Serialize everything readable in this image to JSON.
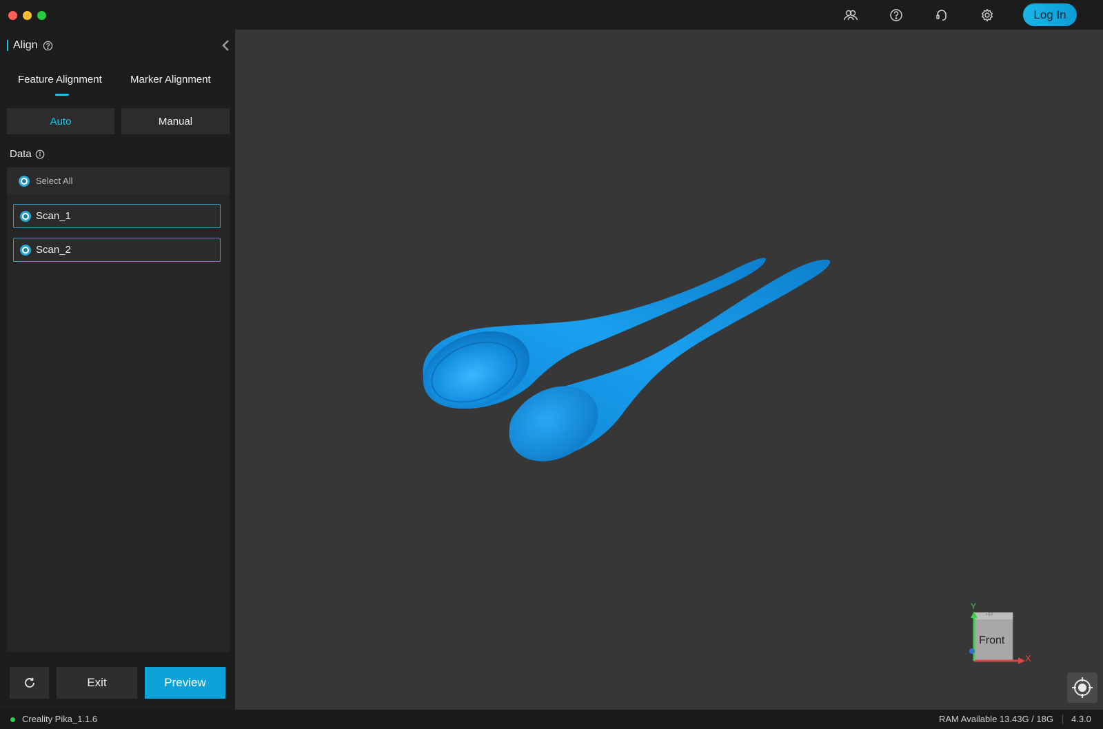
{
  "window": {
    "colors": {
      "accent": "#18c5e8",
      "primary_button": "#0ea2d9",
      "model": "#0f8fd6"
    }
  },
  "topbar": {
    "icons": [
      "community-icon",
      "help-icon",
      "support-icon",
      "settings-icon"
    ],
    "login_label": "Log In"
  },
  "sidebar": {
    "title": "Align",
    "tabs": [
      {
        "label": "Feature Alignment",
        "active": true
      },
      {
        "label": "Marker Alignment",
        "active": false
      }
    ],
    "modes": [
      {
        "label": "Auto",
        "active": true
      },
      {
        "label": "Manual",
        "active": false
      }
    ],
    "data_label": "Data",
    "select_all_label": "Select All",
    "scans": [
      {
        "label": "Scan_1",
        "selected": true
      },
      {
        "label": "Scan_2",
        "selected": true
      }
    ],
    "buttons": {
      "exit": "Exit",
      "preview": "Preview"
    }
  },
  "viewport": {
    "nav_cube": {
      "face_front": "Front",
      "face_top": "Top",
      "axis_x": "X",
      "axis_y": "Y"
    }
  },
  "statusbar": {
    "app_name": "Creality Pika_1.1.6",
    "ram": "RAM Available 13.43G / 18G",
    "version": "4.3.0"
  }
}
